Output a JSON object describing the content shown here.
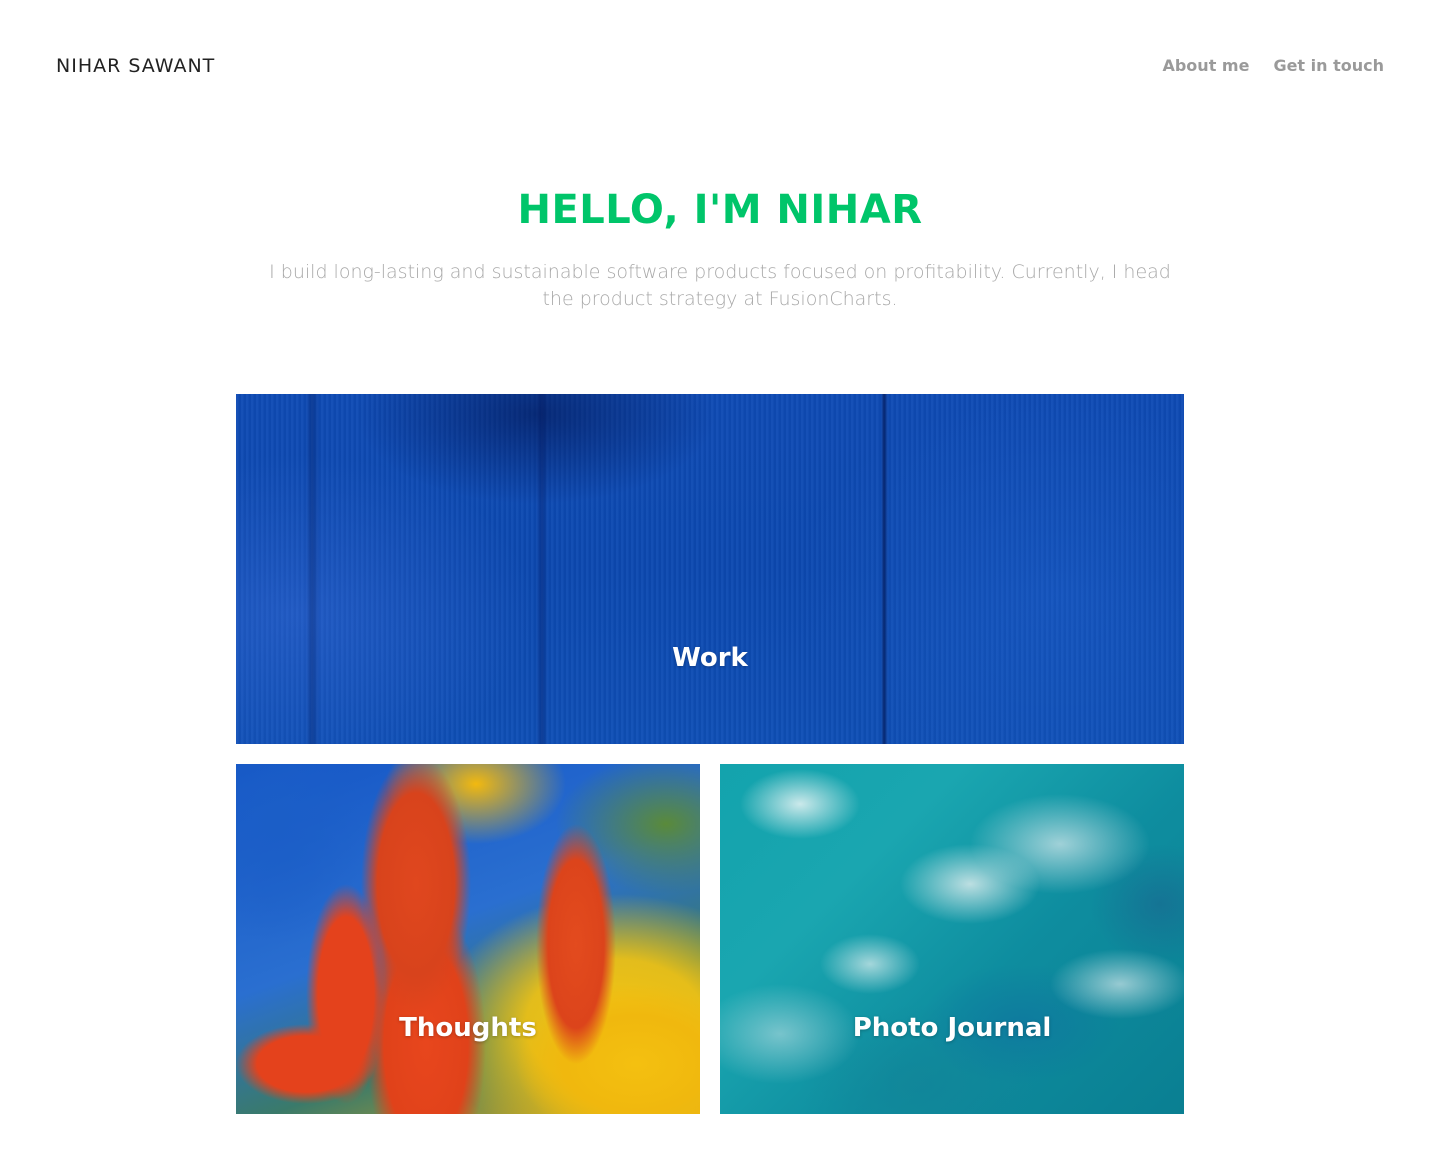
{
  "header": {
    "site_title": "NIHAR SAWANT",
    "nav": [
      {
        "label": "About me"
      },
      {
        "label": "Get in touch"
      }
    ]
  },
  "intro": {
    "heading": "HELLO, I'M NIHAR",
    "description": "I build long-lasting and sustainable software products focused on profitability. Currently, I head the product strategy at FusionCharts."
  },
  "tiles": [
    {
      "label": "Work"
    },
    {
      "label": "Thoughts"
    },
    {
      "label": "Photo Journal"
    }
  ],
  "colors": {
    "accent": "#00c56a",
    "title_text": "#222222",
    "nav_text": "#9a9a9a",
    "body_text": "#a8a8a8",
    "work_tile": "#0f4bb5",
    "thoughts_tile_primary": "#1556c6",
    "thoughts_tile_secondary": "#e4421c",
    "thoughts_tile_tertiary": "#f4c010",
    "photo_tile": "#13a3ad"
  }
}
